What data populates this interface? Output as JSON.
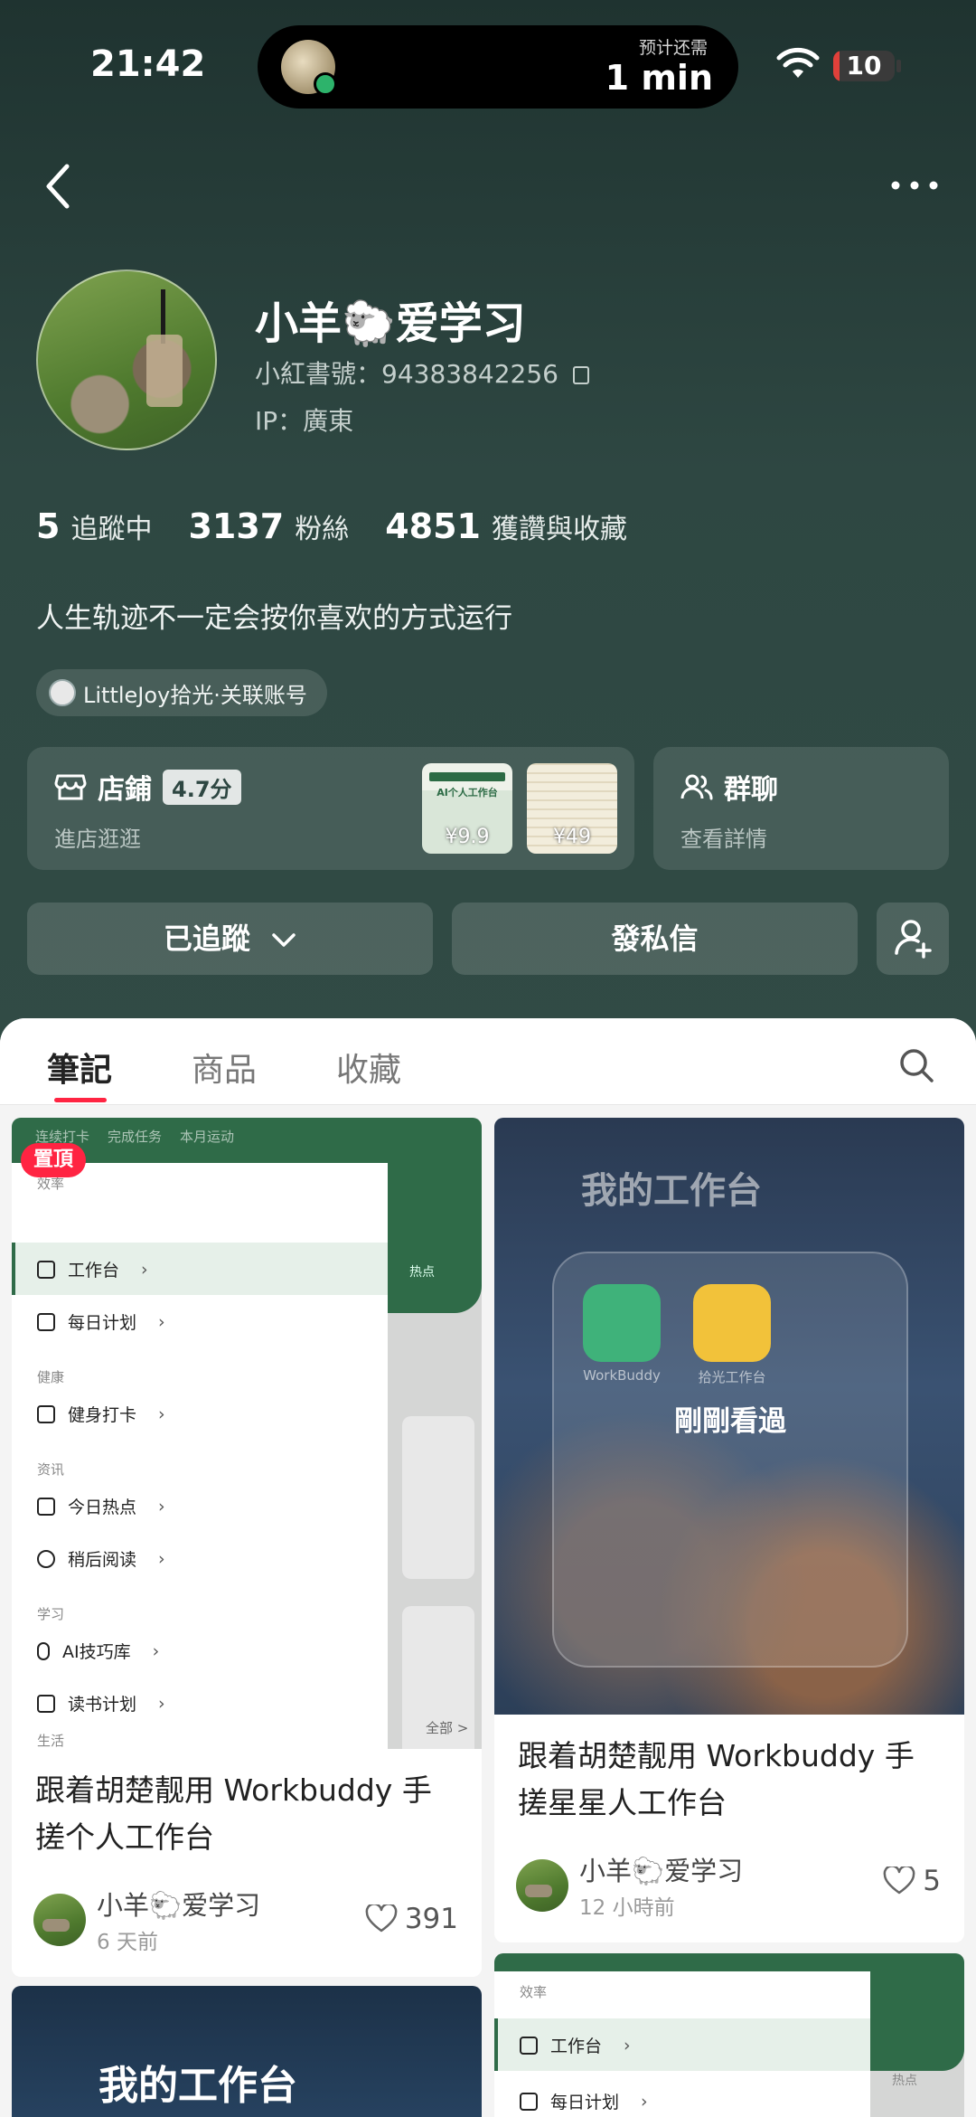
{
  "status_bar": {
    "time": "21:42",
    "island_caption": "预计还需",
    "island_value": "1 min",
    "battery": "10",
    "battery_level": 0.1
  },
  "profile": {
    "name": "小羊🐑爱学习",
    "id_label": "小紅書號：94383842256",
    "ip_label": "IP：廣東",
    "stats": [
      {
        "value": "5",
        "label": "追蹤中"
      },
      {
        "value": "3137",
        "label": "粉絲"
      },
      {
        "value": "4851",
        "label": "獲讚與收藏"
      }
    ],
    "bio": "人生轨迹不一定会按你喜欢的方式运行",
    "linked_account": "LittleJoy拾光·关联账号"
  },
  "shop": {
    "title": "店鋪",
    "rating": "4.7分",
    "subtitle": "進店逛逛",
    "products": [
      {
        "label": "AI个人工作台",
        "price": "¥9.9"
      },
      {
        "price": "¥49"
      }
    ]
  },
  "group": {
    "title": "群聊",
    "subtitle": "查看詳情"
  },
  "actions": {
    "follow": "已追蹤",
    "message": "發私信"
  },
  "tabs": [
    {
      "label": "筆記",
      "active": true
    },
    {
      "label": "商品",
      "active": false
    },
    {
      "label": "收藏",
      "active": false
    }
  ],
  "notes": [
    {
      "badge": "置頂",
      "title": "跟着胡楚靓用 Workbuddy 手搓个人工作台",
      "author": "小羊🐑爱学习",
      "time": "6 天前",
      "likes": "391",
      "mock": {
        "top_tabs": [
          "连续打卡",
          "完成任务",
          "本月运动"
        ],
        "sections": [
          "效率",
          "健康",
          "资讯",
          "学习",
          "生活"
        ],
        "items": [
          "工作台",
          "每日计划",
          "健身打卡",
          "今日热点",
          "稍后阅读",
          "AI技巧库",
          "读书计划"
        ],
        "footer": "全部 >",
        "right_text": "热点"
      }
    },
    {
      "title": "跟着胡楚靓用 Workbuddy 手搓星星人工作台",
      "author": "小羊🐑爱学习",
      "time": "12 小時前",
      "likes": "5",
      "mock": {
        "heading": "我的工作台",
        "apps": [
          "WorkBuddy",
          "拾光工作台"
        ],
        "overlay": "剛剛看過"
      }
    },
    {
      "mock": {
        "heading": "我的工作台"
      }
    },
    {
      "mock": {
        "section": "效率",
        "items": [
          "工作台",
          "每日计划"
        ],
        "right_text": "热点"
      }
    }
  ],
  "colors": {
    "accent": "#ff2442",
    "header_bg": "#2e4742",
    "mock_green": "#2f6b48"
  }
}
